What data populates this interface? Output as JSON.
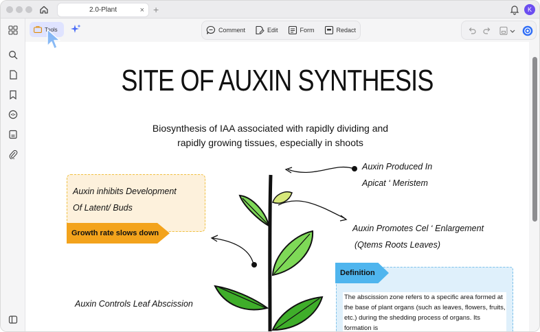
{
  "window": {
    "tab_title": "2.0-Plant",
    "tab_close": "×",
    "new_tab": "+",
    "avatar_initial": "K"
  },
  "toolbar": {
    "tools_label": "Tools",
    "center": [
      {
        "label": "Comment",
        "icon": "comment-icon"
      },
      {
        "label": "Edit",
        "icon": "edit-icon"
      },
      {
        "label": "Form",
        "icon": "form-icon"
      },
      {
        "label": "Redact",
        "icon": "redact-icon"
      }
    ]
  },
  "document": {
    "title": "SITE OF AUXIN SYNTHESIS",
    "subtitle_line1": "Biosynthesis of IAA associated with rapidly dividing and",
    "subtitle_line2": "rapidly growing tissues, especially in shoots",
    "yellow_line1": "Auxin inhibits Development",
    "yellow_line2": "Of Latent/ Buds",
    "orange_banner": "Growth rate slows down",
    "produced_line1": "Auxin Produced In",
    "produced_line2": "Apicat ‘ Meristem",
    "promotes_line1": "Auxin Promotes Cel ‘ Enlargement",
    "promotes_line2": "(Qtems Roots Leaves)",
    "controls": "Auxin Controls Leaf Abscission",
    "definition_tag": "Definition",
    "definition_text": "The abscission zone refers to a specific area formed at the base of plant organs (such as leaves, flowers, fruits, etc.) during the shedding process of organs. Its formation is"
  },
  "colors": {
    "accent": "#6b4df0",
    "tools_active_bg": "#dfe3ff",
    "orange": "#f3a31c",
    "blue": "#4fb5ee",
    "leaf": "#7ed957",
    "leaf_dark": "#3fae2a"
  }
}
